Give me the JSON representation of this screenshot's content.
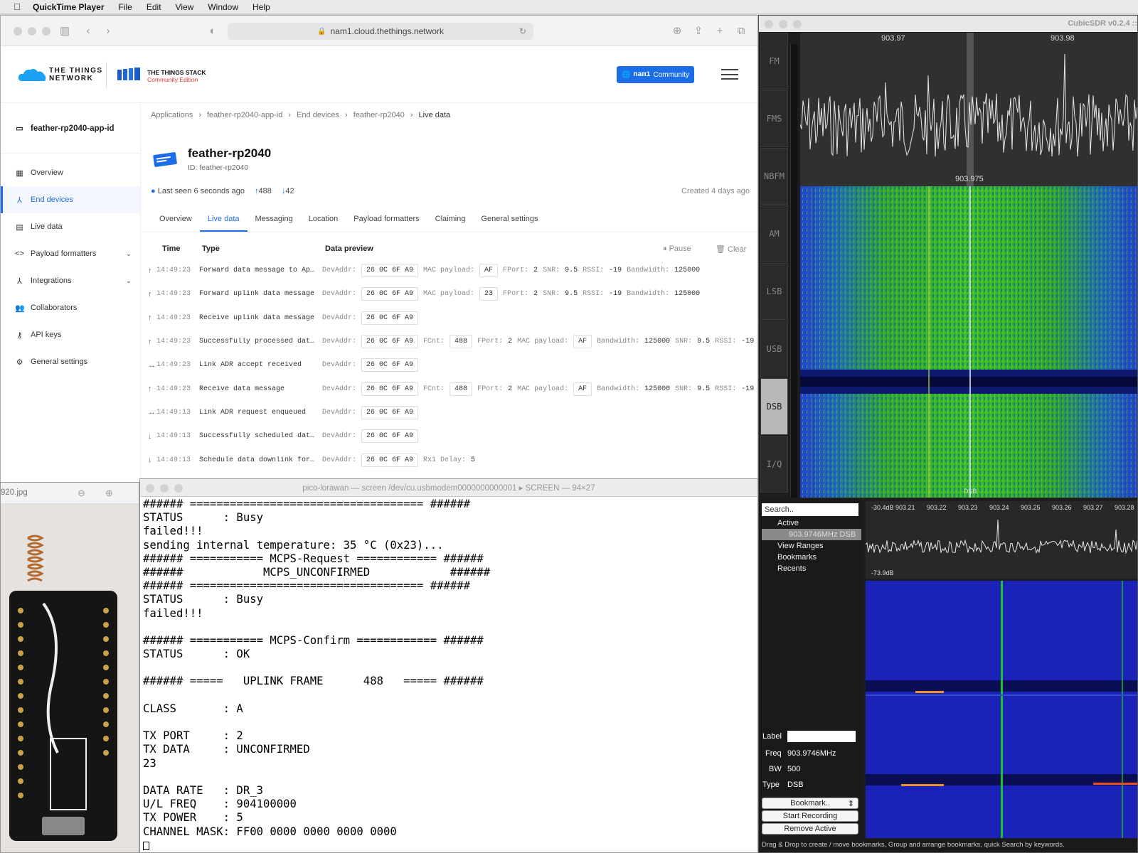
{
  "menubar": {
    "app": "QuickTime Player",
    "items": [
      "File",
      "Edit",
      "View",
      "Window",
      "Help"
    ]
  },
  "safari": {
    "url": "nam1.cloud.thethings.network"
  },
  "ttn": {
    "brand_line1": "THE THINGS",
    "brand_line2": "NETWORK",
    "stack_line1": "THE THINGS STACK",
    "stack_line2": "Community Edition",
    "network_prefix": "nam1",
    "network_label": "Community"
  },
  "sidebar": {
    "app_id": "feather-rp2040-app-id",
    "items": [
      {
        "label": "Overview"
      },
      {
        "label": "End devices"
      },
      {
        "label": "Live data"
      },
      {
        "label": "Payload formatters"
      },
      {
        "label": "Integrations"
      },
      {
        "label": "Collaborators"
      },
      {
        "label": "API keys"
      },
      {
        "label": "General settings"
      }
    ]
  },
  "breadcrumbs": [
    "Applications",
    "feather-rp2040-app-id",
    "End devices",
    "feather-rp2040",
    "Live data"
  ],
  "device": {
    "name": "feather-rp2040",
    "id_label": "ID: feather-rp2040",
    "last_seen": "Last seen 6 seconds ago",
    "uplinks": "488",
    "downlinks": "42",
    "created": "Created 4 days ago"
  },
  "tabs": [
    "Overview",
    "Live data",
    "Messaging",
    "Location",
    "Payload formatters",
    "Claiming",
    "General settings"
  ],
  "live": {
    "col_time": "Time",
    "col_type": "Type",
    "col_preview": "Data preview",
    "pause": "Pause",
    "clear": "Clear",
    "rows": [
      {
        "dir": "↑",
        "time": "14:49:23",
        "type": "Forward data message to Ap…",
        "preview": [
          [
            "DevAddr:",
            "26 0C 6F A9"
          ],
          [
            "MAC payload:",
            "AF"
          ],
          [
            "FPort:",
            "2"
          ],
          [
            "SNR:",
            "9.5"
          ],
          [
            "RSSI:",
            "-19"
          ],
          [
            "Bandwidth:",
            "125000"
          ]
        ]
      },
      {
        "dir": "↑",
        "time": "14:49:23",
        "type": "Forward uplink data message",
        "preview": [
          [
            "DevAddr:",
            "26 0C 6F A9"
          ],
          [
            "MAC payload:",
            "23"
          ],
          [
            "FPort:",
            "2"
          ],
          [
            "SNR:",
            "9.5"
          ],
          [
            "RSSI:",
            "-19"
          ],
          [
            "Bandwidth:",
            "125000"
          ]
        ]
      },
      {
        "dir": "↑",
        "time": "14:49:23",
        "type": "Receive uplink data message",
        "preview": [
          [
            "DevAddr:",
            "26 0C 6F A9"
          ]
        ]
      },
      {
        "dir": "↑",
        "time": "14:49:23",
        "type": "Successfully processed dat…",
        "preview": [
          [
            "DevAddr:",
            "26 0C 6F A9"
          ],
          [
            "FCnt:",
            "488"
          ],
          [
            "FPort:",
            "2"
          ],
          [
            "MAC payload:",
            "AF"
          ],
          [
            "Bandwidth:",
            "125000"
          ],
          [
            "SNR:",
            "9.5"
          ],
          [
            "RSSI:",
            "-19"
          ]
        ]
      },
      {
        "dir": "↔",
        "time": "14:49:23",
        "type": "Link ADR accept received",
        "preview": [
          [
            "DevAddr:",
            "26 0C 6F A9"
          ]
        ]
      },
      {
        "dir": "↑",
        "time": "14:49:23",
        "type": "Receive data message",
        "preview": [
          [
            "DevAddr:",
            "26 0C 6F A9"
          ],
          [
            "FCnt:",
            "488"
          ],
          [
            "FPort:",
            "2"
          ],
          [
            "MAC payload:",
            "AF"
          ],
          [
            "Bandwidth:",
            "125000"
          ],
          [
            "SNR:",
            "9.5"
          ],
          [
            "RSSI:",
            "-19"
          ]
        ]
      },
      {
        "dir": "↔",
        "time": "14:49:13",
        "type": "Link ADR request enqueued",
        "preview": [
          [
            "DevAddr:",
            "26 0C 6F A9"
          ]
        ]
      },
      {
        "dir": "↓",
        "time": "14:49:13",
        "type": "Successfully scheduled dat…",
        "preview": [
          [
            "DevAddr:",
            "26 0C 6F A9"
          ]
        ]
      },
      {
        "dir": "↓",
        "time": "14:49:13",
        "type": "Schedule data downlink for…",
        "preview": [
          [
            "DevAddr:",
            "26 0C 6F A9"
          ],
          [
            "Rx1 Delay:",
            "5"
          ]
        ]
      }
    ]
  },
  "photo": {
    "filename": "920.jpg"
  },
  "terminal": {
    "title": "pico-lorawan — screen /dev/cu.usbmodem0000000000001 ▸ SCREEN — 94×27",
    "lines": [
      "###### =================================== ######",
      "STATUS      : Busy",
      "failed!!!",
      "sending internal temperature: 35 °C (0x23)...",
      "###### =========== MCPS-Request ============ ######",
      "######            MCPS_UNCONFIRMED            ######",
      "###### =================================== ######",
      "STATUS      : Busy",
      "failed!!!",
      "",
      "###### =========== MCPS-Confirm ============ ######",
      "STATUS      : OK",
      "",
      "###### =====   UPLINK FRAME      488   ===== ######",
      "",
      "CLASS       : A",
      "",
      "TX PORT     : 2",
      "TX DATA     : UNCONFIRMED",
      "23",
      "",
      "DATA RATE   : DR_3",
      "U/L FREQ    : 904100000",
      "TX POWER    : 5",
      "CHANNEL MASK: FF00 0000 0000 0000 0000"
    ]
  },
  "cubic": {
    "title": "CubicSDR v0.2.4 ::",
    "modes": [
      "FM",
      "FMS",
      "NBFM",
      "AM",
      "LSB",
      "USB",
      "DSB",
      "I/Q"
    ],
    "selected_mode": "DSB",
    "freq_left": "903.97",
    "freq_right": "903.98",
    "freq_center": "903.975",
    "wf_label": "DSB",
    "search": "Search..",
    "tree": {
      "active": "Active",
      "active_item": "903.9746MHz DSB",
      "view_ranges": "View Ranges",
      "bookmarks": "Bookmarks",
      "recents": "Recents"
    },
    "label_caption": "Label",
    "freq_caption": "Freq",
    "freq_value": "903.9746MHz",
    "bw_caption": "BW",
    "bw_value": "500",
    "type_caption": "Type",
    "type_value": "DSB",
    "bookmark_select": "Bookmark..",
    "start_recording": "Start Recording",
    "remove_active": "Remove Active",
    "spec2_top": "-30.4dB",
    "spec2_bottom": "-73.9dB",
    "spec2_ticks": [
      "903.21",
      "903.22",
      "903.23",
      "903.24",
      "903.25",
      "903.26",
      "903.27",
      "903.28"
    ],
    "status": "Drag & Drop to create / move bookmarks, Group and arrange bookmarks, quick Search by keywords."
  }
}
